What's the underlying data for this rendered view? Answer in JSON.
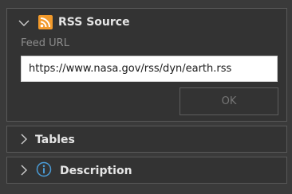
{
  "rss_panel": {
    "title": "RSS Source",
    "icon": "rss-icon",
    "feed_label": "Feed URL",
    "feed_url_value": "https://www.nasa.gov/rss/dyn/earth.rss",
    "ok_label": "OK",
    "expanded": true
  },
  "tables_panel": {
    "title": "Tables",
    "expanded": false
  },
  "description_panel": {
    "title": "Description",
    "icon": "info-icon",
    "expanded": false
  },
  "colors": {
    "background": "#3a3a3a",
    "panel": "#333333",
    "panel_border": "#595959",
    "title_text": "#e6e6e6",
    "label_text": "#8b8b8b",
    "rss_orange": "#f29a2b",
    "info_blue": "#4a9bd6",
    "disabled_text": "#767676"
  }
}
